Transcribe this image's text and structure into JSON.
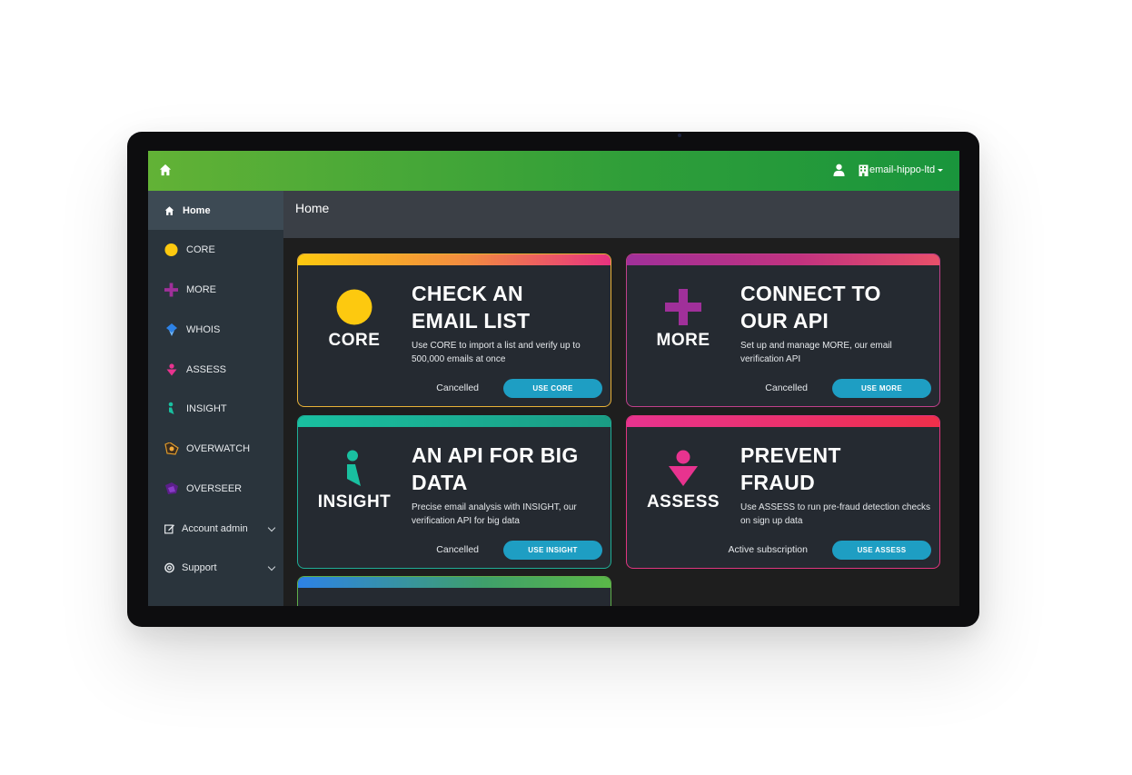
{
  "account": {
    "name": "email-hippo-ltd"
  },
  "sidebar": {
    "items": [
      {
        "label": "Home",
        "icon": "home-icon"
      },
      {
        "label": "CORE",
        "icon": "core-circle-icon"
      },
      {
        "label": "MORE",
        "icon": "more-plus-icon"
      },
      {
        "label": "WHOIS",
        "icon": "whois-diamond-icon"
      },
      {
        "label": "ASSESS",
        "icon": "assess-icon"
      },
      {
        "label": "INSIGHT",
        "icon": "insight-icon"
      },
      {
        "label": "OVERWATCH",
        "icon": "overwatch-icon"
      },
      {
        "label": "OVERSEER",
        "icon": "overseer-icon"
      },
      {
        "label": "Account admin",
        "icon": "edit-icon"
      },
      {
        "label": "Support",
        "icon": "lifebuoy-icon"
      }
    ]
  },
  "page": {
    "title": "Home"
  },
  "cards": [
    {
      "product": "CORE",
      "heading_line1": "CHECK AN",
      "heading_line2": "EMAIL LIST",
      "description": "Use CORE to import a list and verify up to 500,000 emails at once",
      "status": "Cancelled",
      "button": "USE CORE"
    },
    {
      "product": "MORE",
      "heading_line1": "CONNECT TO",
      "heading_line2": "OUR API",
      "description": "Set up and manage MORE, our email verification API",
      "status": "Cancelled",
      "button": "USE MORE"
    },
    {
      "product": "INSIGHT",
      "heading_line1": "AN API FOR BIG",
      "heading_line2": "DATA",
      "description": "Precise email analysis with INSIGHT, our verification API for big data",
      "status": "Cancelled",
      "button": "USE INSIGHT"
    },
    {
      "product": "ASSESS",
      "heading_line1": "PREVENT",
      "heading_line2": "FRAUD",
      "description": "Use ASSESS to run pre-fraud detection checks on sign up data",
      "status": "Active subscription",
      "button": "USE ASSESS"
    }
  ],
  "colors": {
    "topbar_start": "#62b236",
    "topbar_end": "#19953c",
    "core": "#fdc90f",
    "more": "#a0309a",
    "insight": "#19c0a0",
    "assess": "#e8338f",
    "button": "#1e9ec3"
  }
}
